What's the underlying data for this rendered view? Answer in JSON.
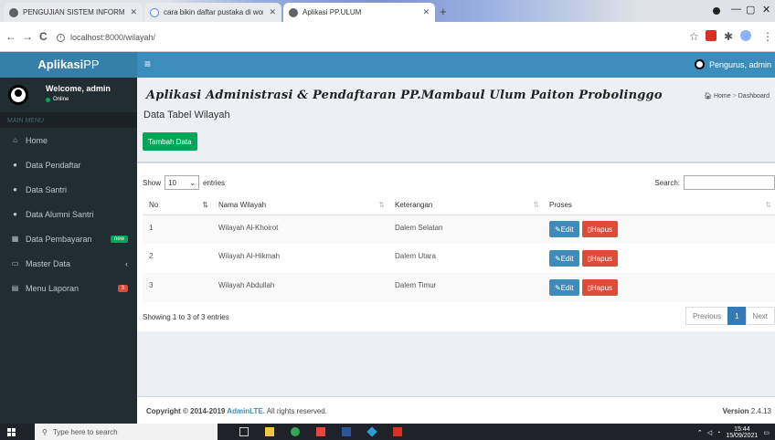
{
  "browser": {
    "tabs": [
      {
        "label": "PENGUJIAN SISTEM INFORMASI",
        "active": false
      },
      {
        "label": "cara bikin daftar pustaka di word",
        "active": false
      },
      {
        "label": "Aplikasi PP.ULUM",
        "active": true
      }
    ],
    "new_tab": "+",
    "url": "localhost:8000/wilayah/",
    "back": "←",
    "forward": "→",
    "reload": "C",
    "window_controls": {
      "minimize": "—",
      "maximize": "▢",
      "close": "✕"
    }
  },
  "sidebar": {
    "logo_bold": "Aplikasi",
    "logo_rest": "PP",
    "user_name": "Welcome, admin",
    "user_status": "Online",
    "menu_header": "MAIN MENU",
    "items": [
      {
        "label": "Home",
        "icon": "home-icon"
      },
      {
        "label": "Data Pendaftar",
        "icon": "user-icon"
      },
      {
        "label": "Data Santri",
        "icon": "user-icon"
      },
      {
        "label": "Data Alumni Santri",
        "icon": "user-icon"
      },
      {
        "label": "Data Pembayaran",
        "icon": "table-icon",
        "badge": "new",
        "badge_color": "#00a65a"
      },
      {
        "label": "Master Data",
        "icon": "laptop-icon",
        "caret": "‹"
      },
      {
        "label": "Menu Laporan",
        "icon": "calendar-icon",
        "badge": "3",
        "badge_color": "#dd4b39"
      }
    ]
  },
  "header": {
    "toggle": "≡",
    "user_label": "Pengurus, admin"
  },
  "content": {
    "app_title": "Aplikasi Administrasi & Pendaftaran PP.Mambaul Ulum Paiton Probolinggo",
    "breadcrumb": {
      "home": "Home",
      "sep": ">",
      "current": "Dashboard"
    },
    "page_title": "Data Tabel Wilayah",
    "add_button": "Tambah Data",
    "show_label": "Show",
    "show_value": "10",
    "entries_label": "entries",
    "search_label": "Search:",
    "columns": [
      "No",
      "Nama Wilayah",
      "Keterangan",
      "Proses"
    ],
    "rows": [
      {
        "no": "1",
        "nama": "Wilayah Al-Khoirot",
        "ket": "Dalem Selatan"
      },
      {
        "no": "2",
        "nama": "Wilayah Al-Hikmah",
        "ket": "Dalem Utara"
      },
      {
        "no": "3",
        "nama": "Wilayah Abdullah",
        "ket": "Dalem Timur"
      }
    ],
    "edit_label": "Edit",
    "delete_label": "Hapus",
    "showing_text": "Showing 1 to 3 of 3 entries",
    "pager": {
      "prev": "Previous",
      "page": "1",
      "next": "Next"
    }
  },
  "footer": {
    "copy_prefix": "Copyright © 2014-2019 ",
    "copy_link": "AdminLTE.",
    "copy_suffix": " All rights reserved.",
    "version_label": "Version",
    "version_value": "2.4.13"
  },
  "taskbar": {
    "search_placeholder": "Type here to search",
    "time": "15:44",
    "date": "15/09/2021"
  },
  "colors": {
    "header": "#3c8dbc",
    "logo": "#367fa9",
    "sidebar": "#222d32",
    "success": "#00a65a",
    "danger": "#dd4b39"
  }
}
